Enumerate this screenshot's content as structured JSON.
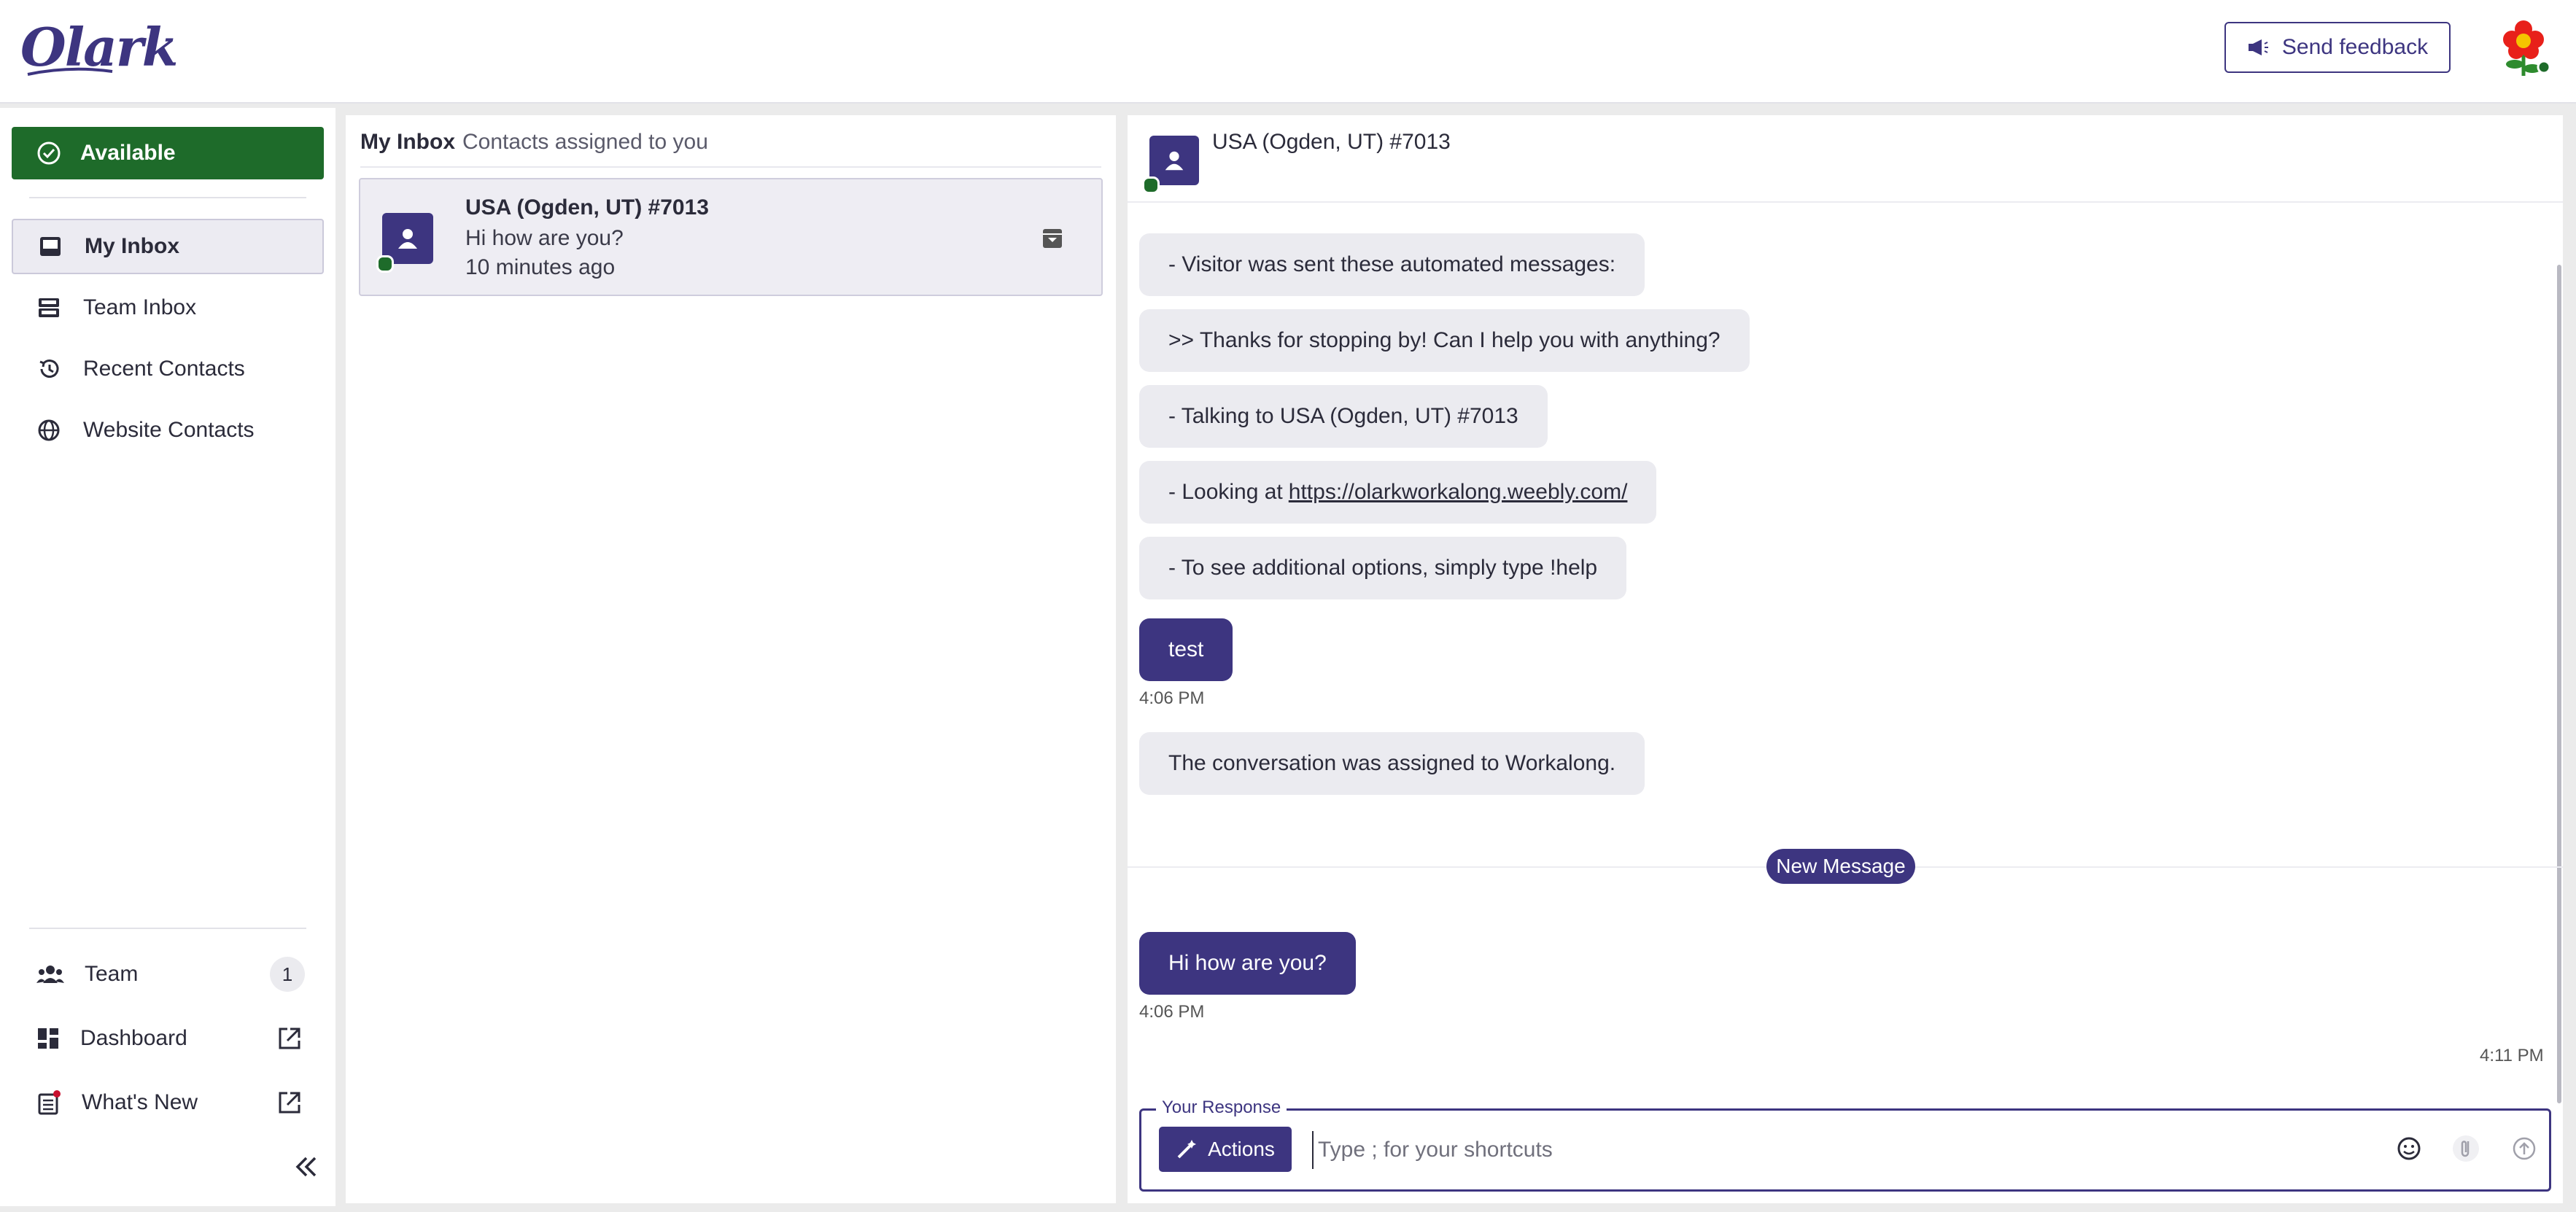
{
  "app": {
    "logo_text": "Olark"
  },
  "header": {
    "feedback_label": "Send feedback"
  },
  "sidebar": {
    "status_label": "Available",
    "nav": [
      {
        "label": "My Inbox",
        "icon": "inbox-icon"
      },
      {
        "label": "Team Inbox",
        "icon": "team-inbox-icon"
      },
      {
        "label": "Recent Contacts",
        "icon": "history-icon"
      },
      {
        "label": "Website Contacts",
        "icon": "globe-icon"
      }
    ],
    "bottom": {
      "team_label": "Team",
      "team_count": "1",
      "dashboard_label": "Dashboard",
      "whats_new_label": "What's New"
    }
  },
  "inbox": {
    "title": "My Inbox",
    "subtitle": "Contacts assigned to you",
    "contacts": [
      {
        "name": "USA (Ogden, UT) #7013",
        "last_message": "Hi how are you?",
        "time": "10 minutes ago"
      }
    ]
  },
  "chat": {
    "title": "USA (Ogden, UT) #7013",
    "messages": {
      "m1": "- Visitor was sent these automated messages:",
      "m2": ">> Thanks for stopping by! Can I help you with anything?",
      "m3": "- Talking to USA (Ogden, UT) #7013",
      "m4_prefix": "- Looking at",
      "m4_link": "https://olarkworkalong.weebly.com/",
      "m5": "- To see additional options, simply type !help",
      "m6": "test",
      "m6_time": "4:06 PM",
      "m7": "The conversation was assigned to Workalong.",
      "new_message_label": "New Message",
      "m8": "Hi how are you?",
      "m8_time": "4:06 PM",
      "latest_time": "4:11 PM"
    },
    "response": {
      "legend": "Your Response",
      "actions_label": "Actions",
      "placeholder": "Type ; for your shortcuts"
    }
  },
  "colors": {
    "brand": "#3d3580",
    "available": "#1e6b2a",
    "bubble": "#ebebf0"
  }
}
